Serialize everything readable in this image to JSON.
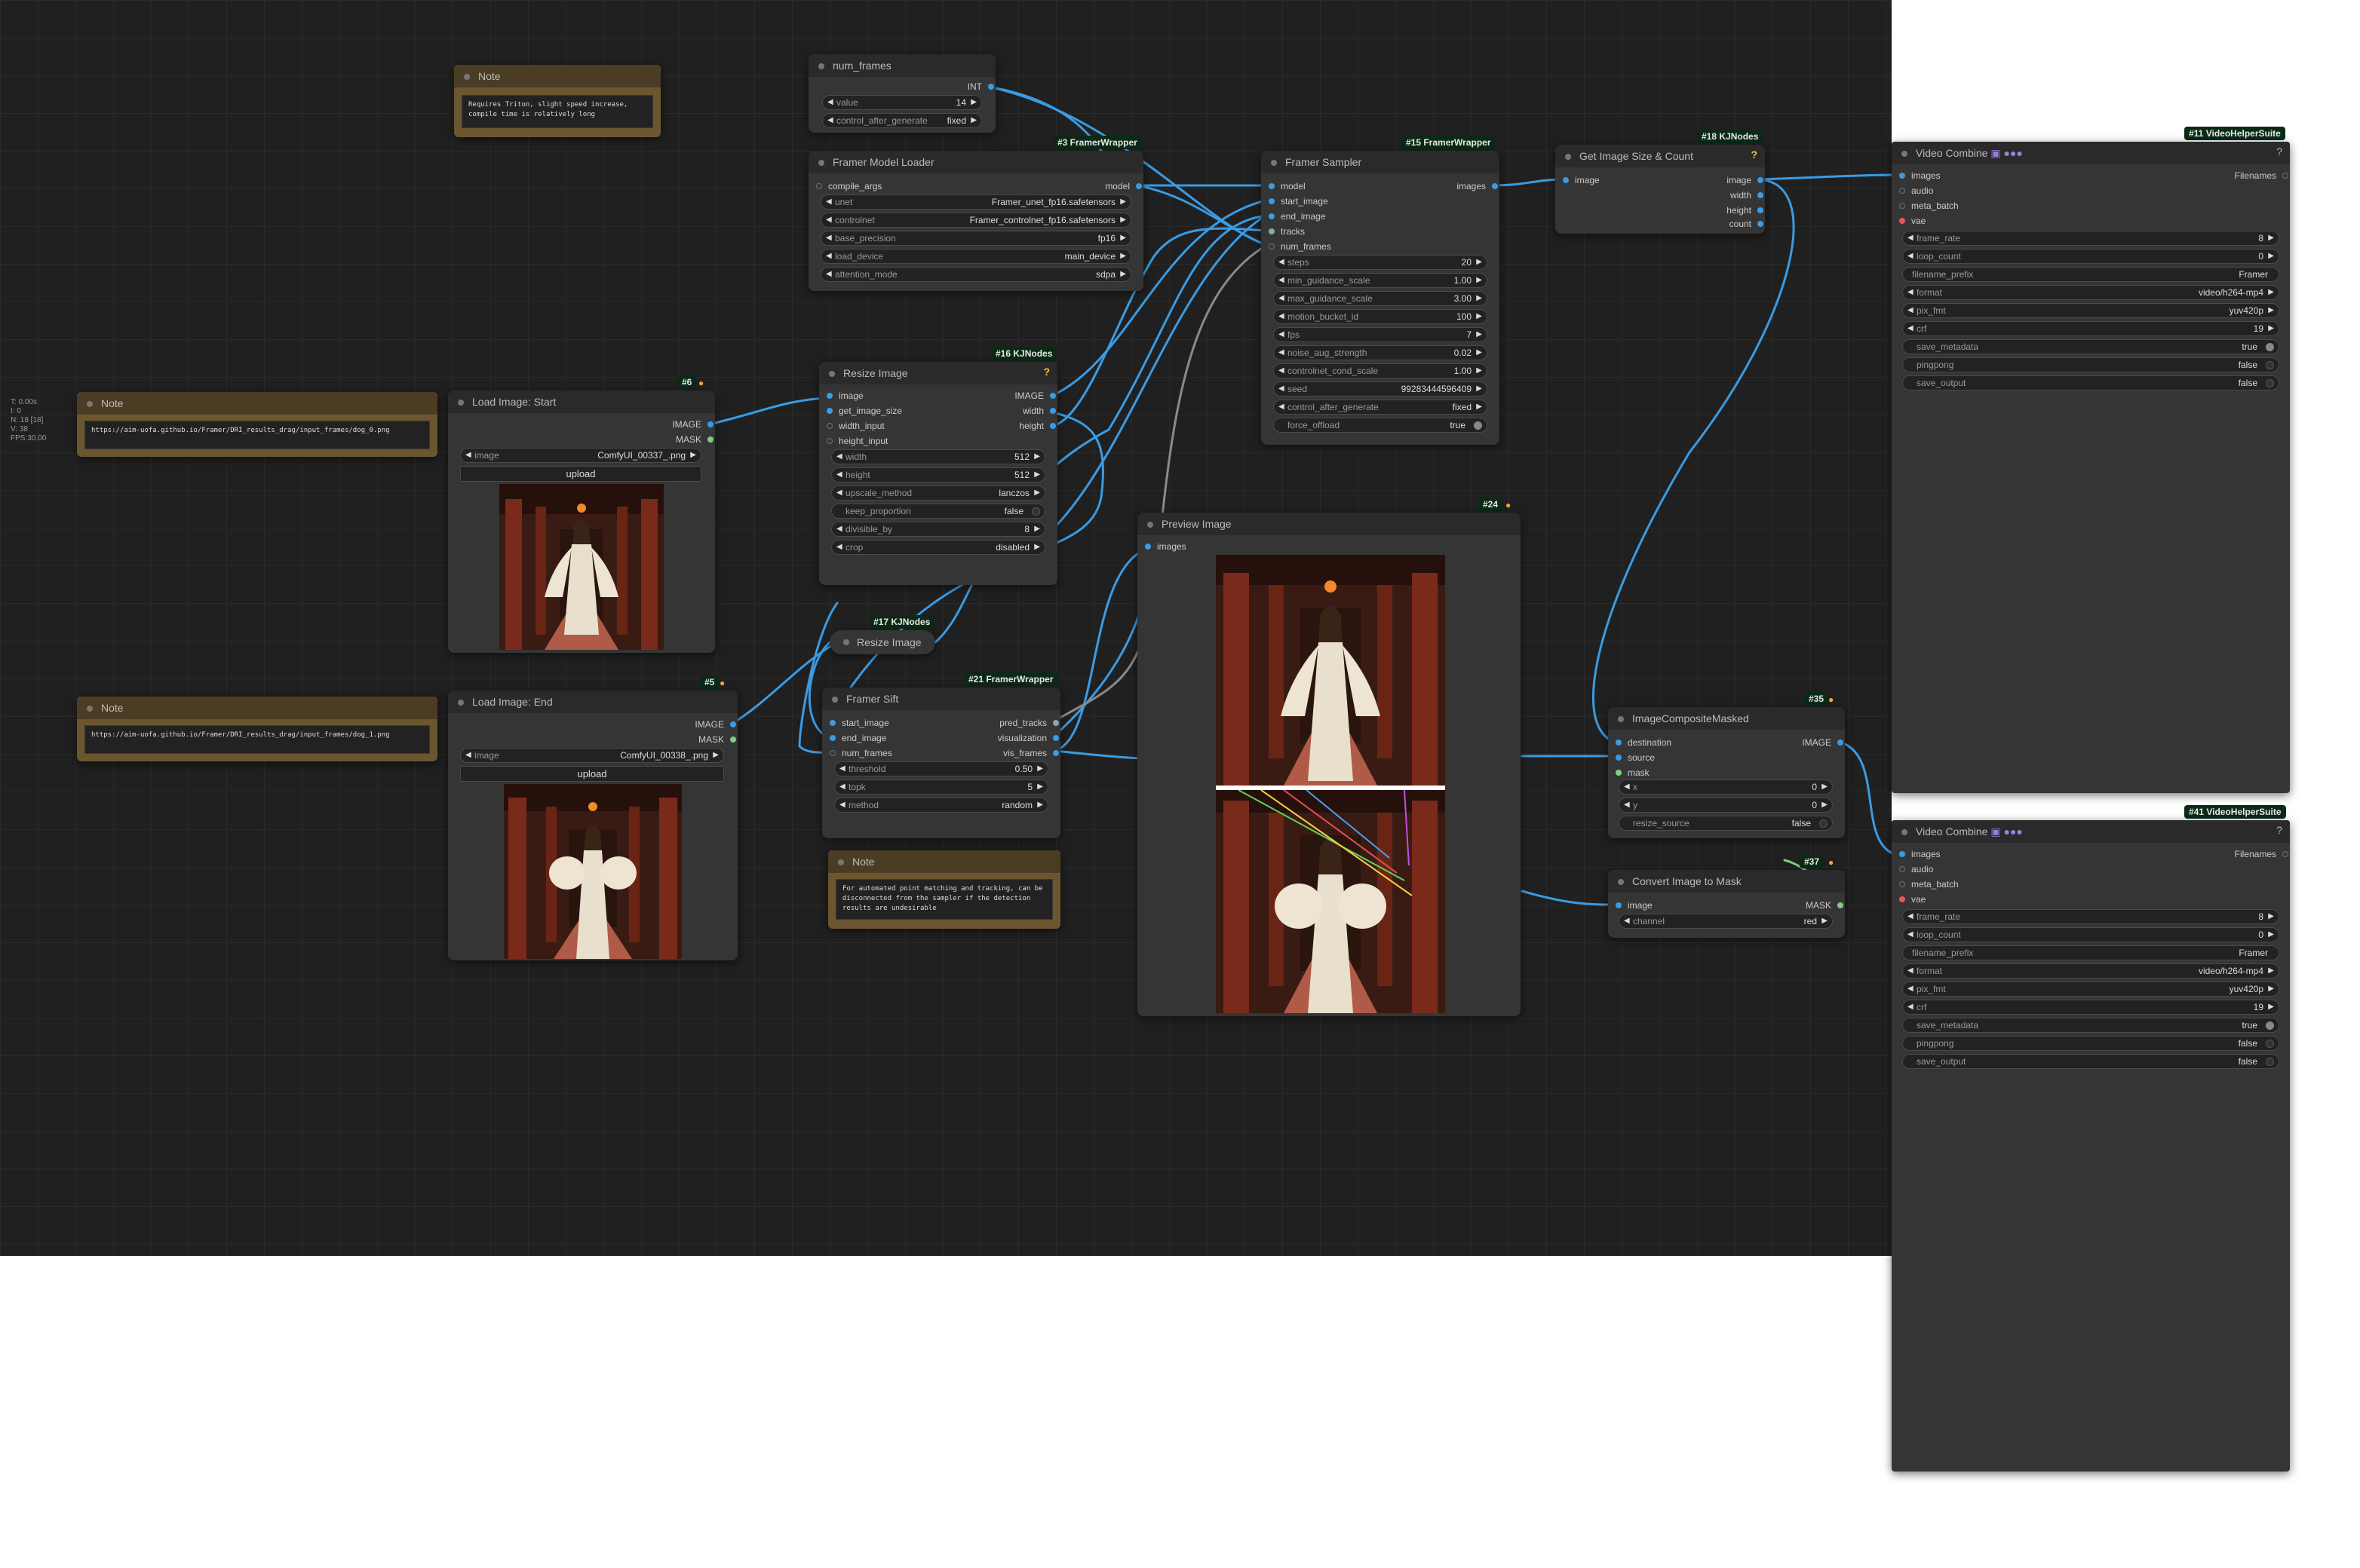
{
  "stats": {
    "lines": [
      "T: 0.00s",
      "I: 0",
      "N: 18 [18]",
      "V: 38",
      "FPS:30.00"
    ]
  },
  "notes": {
    "triton": {
      "title": "Note",
      "text": "Requires Triton, slight speed increase, compile time is relatively long"
    },
    "start": {
      "title": "Note",
      "text": "https://aim-uofa.github.io/Framer/DRI_results_drag/input_frames/dog_0.png"
    },
    "end": {
      "title": "Note",
      "text": "https://aim-uofa.github.io/Framer/DRI_results_drag/input_frames/dog_1.png"
    },
    "sift": {
      "title": "Note",
      "text": "For automated point matching and tracking, can be disconnected from the sampler if the detection results are undesirable"
    }
  },
  "num_frames": {
    "title": "num_frames",
    "out": "INT",
    "value_label": "value",
    "value": "14",
    "cag_label": "control_after_generate",
    "cag": "fixed"
  },
  "model_loader": {
    "badge": "#3 FramerWrapper",
    "title": "Framer Model Loader",
    "in": "compile_args",
    "out": "model",
    "widgets": [
      {
        "l": "unet",
        "v": "Framer_unet_fp16.safetensors"
      },
      {
        "l": "controlnet",
        "v": "Framer_controlnet_fp16.safetensors"
      },
      {
        "l": "base_precision",
        "v": "fp16"
      },
      {
        "l": "load_device",
        "v": "main_device"
      },
      {
        "l": "attention_mode",
        "v": "sdpa"
      }
    ]
  },
  "load_start": {
    "badge": "#6",
    "title": "Load Image: Start",
    "out1": "IMAGE",
    "out2": "MASK",
    "image_label": "image",
    "image": "ComfyUI_00337_.png",
    "upload": "upload"
  },
  "load_end": {
    "badge": "#5",
    "title": "Load Image: End",
    "out1": "IMAGE",
    "out2": "MASK",
    "image_label": "image",
    "image": "ComfyUI_00338_.png",
    "upload": "upload"
  },
  "resize": {
    "badge": "#16 KJNodes",
    "title": "Resize Image",
    "ins": [
      "image",
      "get_image_size",
      "width_input",
      "height_input"
    ],
    "outs": [
      "IMAGE",
      "width",
      "height"
    ],
    "widgets": [
      {
        "l": "width",
        "v": "512"
      },
      {
        "l": "height",
        "v": "512"
      },
      {
        "l": "upscale_method",
        "v": "lanczos"
      },
      {
        "l": "keep_proportion",
        "v": "false",
        "toggle": true
      },
      {
        "l": "divisible_by",
        "v": "8"
      },
      {
        "l": "crop",
        "v": "disabled"
      }
    ]
  },
  "resize2": {
    "badge": "#17 KJNodes",
    "title": "Resize Image"
  },
  "sift": {
    "badge": "#21 FramerWrapper",
    "title": "Framer Sift",
    "ins": [
      "start_image",
      "end_image",
      "num_frames"
    ],
    "outs": [
      "pred_tracks",
      "visualization",
      "vis_frames"
    ],
    "widgets": [
      {
        "l": "threshold",
        "v": "0.50"
      },
      {
        "l": "topk",
        "v": "5"
      },
      {
        "l": "method",
        "v": "random"
      }
    ]
  },
  "sampler": {
    "badge": "#15 FramerWrapper",
    "title": "Framer Sampler",
    "ins": [
      "model",
      "start_image",
      "end_image",
      "tracks",
      "num_frames"
    ],
    "out": "images",
    "widgets": [
      {
        "l": "steps",
        "v": "20"
      },
      {
        "l": "min_guidance_scale",
        "v": "1.00"
      },
      {
        "l": "max_guidance_scale",
        "v": "3.00"
      },
      {
        "l": "motion_bucket_id",
        "v": "100"
      },
      {
        "l": "fps",
        "v": "7"
      },
      {
        "l": "noise_aug_strength",
        "v": "0.02"
      },
      {
        "l": "controlnet_cond_scale",
        "v": "1.00"
      },
      {
        "l": "seed",
        "v": "99283444596409"
      },
      {
        "l": "control_after_generate",
        "v": "fixed"
      },
      {
        "l": "force_offload",
        "v": "true",
        "toggle": true
      }
    ]
  },
  "preview": {
    "badge": "#24",
    "title": "Preview Image",
    "in": "images"
  },
  "getsize": {
    "badge": "#18 KJNodes",
    "title": "Get Image Size & Count",
    "in": "image",
    "outs": [
      "image",
      "width",
      "height",
      "count"
    ]
  },
  "composite": {
    "badge": "#35",
    "title": "ImageCompositeMasked",
    "ins": [
      "destination",
      "source",
      "mask"
    ],
    "out": "IMAGE",
    "widgets": [
      {
        "l": "x",
        "v": "0"
      },
      {
        "l": "y",
        "v": "0"
      },
      {
        "l": "resize_source",
        "v": "false",
        "toggle": true
      }
    ]
  },
  "convert": {
    "badge": "#37",
    "title": "Convert Image to Mask",
    "in": "image",
    "out": "MASK",
    "w_label": "channel",
    "w_value": "red"
  },
  "vc1": {
    "badge": "#11 VideoHelperSuite",
    "title": "Video Combine",
    "ins": [
      "images",
      "audio",
      "meta_batch",
      "vae"
    ],
    "out": "Filenames",
    "widgets": [
      {
        "l": "frame_rate",
        "v": "8"
      },
      {
        "l": "loop_count",
        "v": "0"
      },
      {
        "l": "filename_prefix",
        "v": "Framer",
        "plain": true
      },
      {
        "l": "format",
        "v": "video/h264-mp4"
      },
      {
        "l": "pix_fmt",
        "v": "yuv420p"
      },
      {
        "l": "crf",
        "v": "19"
      },
      {
        "l": "save_metadata",
        "v": "true",
        "toggle": true
      },
      {
        "l": "pingpong",
        "v": "false",
        "toggle": true
      },
      {
        "l": "save_output",
        "v": "false",
        "toggle": true
      }
    ]
  },
  "vc2": {
    "badge": "#41 VideoHelperSuite",
    "title": "Video Combine",
    "ins": [
      "images",
      "audio",
      "meta_batch",
      "vae"
    ],
    "out": "Filenames",
    "widgets": [
      {
        "l": "frame_rate",
        "v": "8"
      },
      {
        "l": "loop_count",
        "v": "0"
      },
      {
        "l": "filename_prefix",
        "v": "Framer",
        "plain": true
      },
      {
        "l": "format",
        "v": "video/h264-mp4"
      },
      {
        "l": "pix_fmt",
        "v": "yuv420p"
      },
      {
        "l": "crf",
        "v": "19"
      },
      {
        "l": "save_metadata",
        "v": "true",
        "toggle": true
      },
      {
        "l": "pingpong",
        "v": "false",
        "toggle": true
      },
      {
        "l": "save_output",
        "v": "false",
        "toggle": true
      }
    ]
  },
  "colors": {
    "canvas": "#202020",
    "node": "#353535",
    "link": "#3b9be3",
    "note": "#6b5630",
    "badge": "#0a2a16"
  }
}
